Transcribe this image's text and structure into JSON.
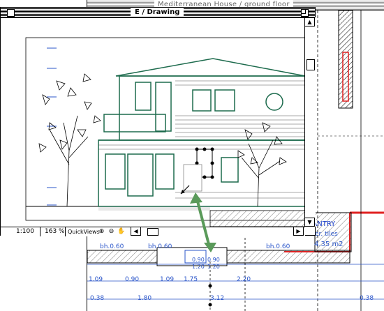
{
  "back_window": {
    "title": "Mediterranean House / ground floor",
    "room_name": "PANTRY",
    "room_finish": "cer. tiles",
    "room_area": "4.35 m2",
    "openings": [
      "bh.0.60",
      "bh.0.60",
      "bh.0.60"
    ],
    "dims_row1": [
      "1.09",
      "0.90",
      "1.09",
      "1.75",
      "2.20"
    ],
    "dims_row2": [
      "0.38",
      "1.80",
      "3.12",
      "0.38"
    ],
    "vertical_dims": [
      "0.90",
      "1.20",
      "0.90",
      "1.20"
    ]
  },
  "front_window": {
    "title": "E / Drawing",
    "status": {
      "scale": "1:100",
      "zoom": "163 %",
      "quickviews": "QuickViews"
    }
  },
  "colors": {
    "wall_red": "#e02020",
    "dim_blue": "#2a55c9",
    "arrow_green": "#5a9a5a",
    "drawing_green": "#1d6b4d"
  },
  "icons": [
    "zoom-in-icon",
    "zoom-out-icon",
    "hand-icon",
    "scroll-up-icon",
    "scroll-down-icon",
    "scroll-left-icon",
    "scroll-right-icon"
  ]
}
